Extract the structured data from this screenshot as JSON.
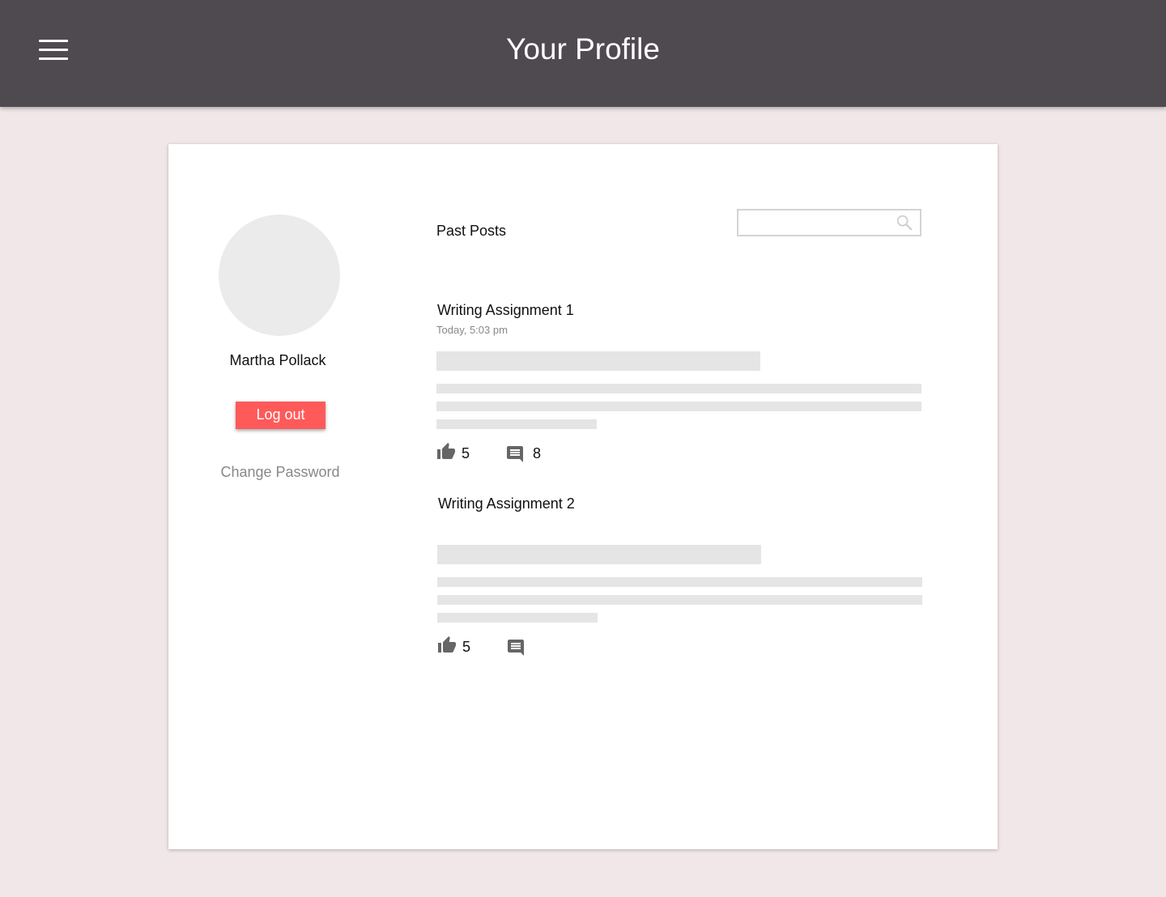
{
  "header": {
    "title": "Your Profile",
    "menu_icon": "hamburger-menu-icon"
  },
  "profile": {
    "name": "Martha Pollack",
    "logout_label": "Log out",
    "change_password_label": "Change Password"
  },
  "posts_section": {
    "title": "Past Posts",
    "search": {
      "value": "",
      "placeholder": "",
      "icon": "search-icon"
    }
  },
  "posts": [
    {
      "title": "Writing Assignment 1",
      "timestamp": "Today, 5:03 pm",
      "likes": "5",
      "comments": "8"
    },
    {
      "title": "Writing Assignment 2",
      "timestamp": "",
      "likes": "5",
      "comments": ""
    }
  ],
  "colors": {
    "header_bg": "#4f4950",
    "page_bg": "#f1e7e8",
    "logout_bg": "#ff5a5a",
    "placeholder_bar": "#e5e5e5"
  }
}
